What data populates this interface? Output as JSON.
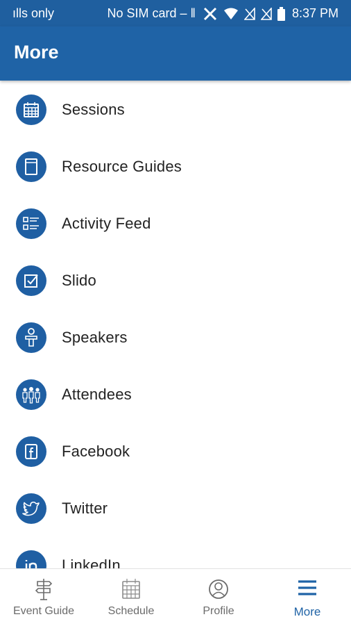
{
  "status_bar": {
    "carrier": "ılls only",
    "sim": "No SIM card – ‖",
    "time": "8:37 PM",
    "icons": [
      "tools-icon",
      "wifi-icon",
      "no-signal-icon",
      "no-signal-icon",
      "battery-icon"
    ]
  },
  "app_bar": {
    "title": "More"
  },
  "menu": {
    "items": [
      {
        "label": "Sessions",
        "icon": "calendar-icon"
      },
      {
        "label": "Resource Guides",
        "icon": "book-icon"
      },
      {
        "label": "Activity Feed",
        "icon": "list-icon"
      },
      {
        "label": "Slido",
        "icon": "checkbox-icon"
      },
      {
        "label": "Speakers",
        "icon": "speaker-podium-icon"
      },
      {
        "label": "Attendees",
        "icon": "people-icon"
      },
      {
        "label": "Facebook",
        "icon": "facebook-icon"
      },
      {
        "label": "Twitter",
        "icon": "twitter-icon"
      },
      {
        "label": "LinkedIn",
        "icon": "linkedin-icon"
      }
    ]
  },
  "bottom_nav": {
    "tabs": [
      {
        "label": "Event Guide",
        "icon": "signpost-icon",
        "active": false
      },
      {
        "label": "Schedule",
        "icon": "calendar-icon",
        "active": false
      },
      {
        "label": "Profile",
        "icon": "profile-icon",
        "active": false
      },
      {
        "label": "More",
        "icon": "hamburger-icon",
        "active": true
      }
    ]
  },
  "colors": {
    "primary": "#1f63a6",
    "status_bar": "#1f5f9f",
    "icon_circle": "#1f5fa3",
    "text": "#222222",
    "nav_inactive": "#6b6b6b"
  }
}
